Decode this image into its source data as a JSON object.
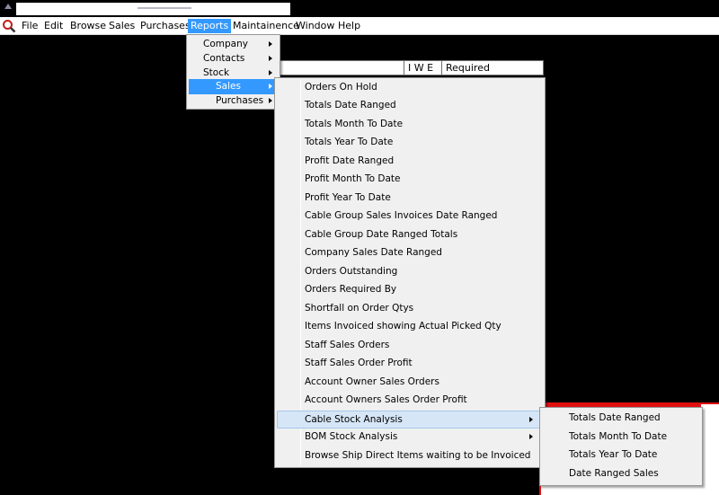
{
  "menubar": {
    "items": [
      "File",
      "Edit",
      "Browse",
      "Sales",
      "Purchases",
      "Reports",
      "Maintainence",
      "Window",
      "Help"
    ]
  },
  "workspace_header": {
    "cells": [
      "I W E",
      "Required"
    ]
  },
  "reports_menu": {
    "items": [
      {
        "label": "Company",
        "submenu": true
      },
      {
        "label": "Contacts",
        "submenu": true
      },
      {
        "label": "Stock",
        "submenu": true
      },
      {
        "label": "Sales",
        "submenu": true,
        "highlighted": true
      },
      {
        "label": "Purchases",
        "submenu": true
      }
    ]
  },
  "sales_menu": {
    "items": [
      {
        "label": "Orders On Hold"
      },
      {
        "label": "Totals Date Ranged"
      },
      {
        "label": "Totals Month To Date"
      },
      {
        "label": "Totals Year To Date"
      },
      {
        "label": "Profit Date Ranged"
      },
      {
        "label": "Profit Month To Date"
      },
      {
        "label": "Profit Year To Date"
      },
      {
        "label": "Cable Group Sales Invoices Date Ranged"
      },
      {
        "label": "Cable Group Date Ranged Totals"
      },
      {
        "label": "Company Sales Date Ranged"
      },
      {
        "label": "Orders Outstanding"
      },
      {
        "label": "Orders Required By"
      },
      {
        "label": "Shortfall on Order Qtys"
      },
      {
        "label": "Items Invoiced showing Actual Picked Qty"
      },
      {
        "label": "Staff Sales Orders"
      },
      {
        "label": "Staff Sales Order Profit"
      },
      {
        "label": "Account Owner Sales Orders"
      },
      {
        "label": "Account Owners Sales Order Profit"
      },
      {
        "label": "Cable Stock Analysis",
        "submenu": true,
        "highlighted": true
      },
      {
        "label": "BOM Stock Analysis",
        "submenu": true
      },
      {
        "label": "Browse Ship Direct Items waiting to be Invoiced"
      }
    ]
  },
  "cable_stock_menu": {
    "items": [
      {
        "label": "Totals Date Ranged"
      },
      {
        "label": "Totals Month To Date"
      },
      {
        "label": "Totals Year To Date"
      },
      {
        "label": "Date Ranged Sales"
      }
    ]
  },
  "colors": {
    "highlight": "#3399ff",
    "soft_highlight": "#d6e6f6",
    "menu_bg": "#f0f0f0",
    "desktop": "#000000",
    "alert_panel": "#e01010"
  },
  "icons": [
    "app-icon",
    "submenu-arrow-icon"
  ]
}
